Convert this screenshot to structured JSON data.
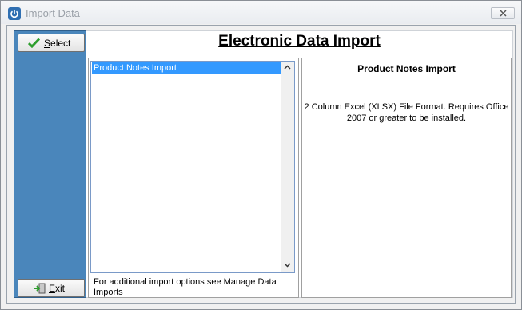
{
  "window": {
    "title": "Import Data",
    "close_label": "Close"
  },
  "sidebar": {
    "select_button": {
      "underline": "S",
      "rest": "elect",
      "icon": "checkmark-icon"
    },
    "exit_button": {
      "underline": "E",
      "rest": "xit",
      "icon": "exit-door-icon"
    }
  },
  "main": {
    "title": "Electronic Data Import",
    "list": {
      "items": [
        "Product Notes Import"
      ],
      "selected_index": 0
    },
    "footnote": "For additional import options see Manage Data Imports",
    "detail": {
      "title": "Product Notes Import",
      "description": "2 Column Excel (XLSX) File Format.  Requires Office 2007 or greater to be installed."
    }
  },
  "colors": {
    "sidebar": "#4a86bb",
    "selection": "#3399ff",
    "check": "#2e9e2e"
  }
}
